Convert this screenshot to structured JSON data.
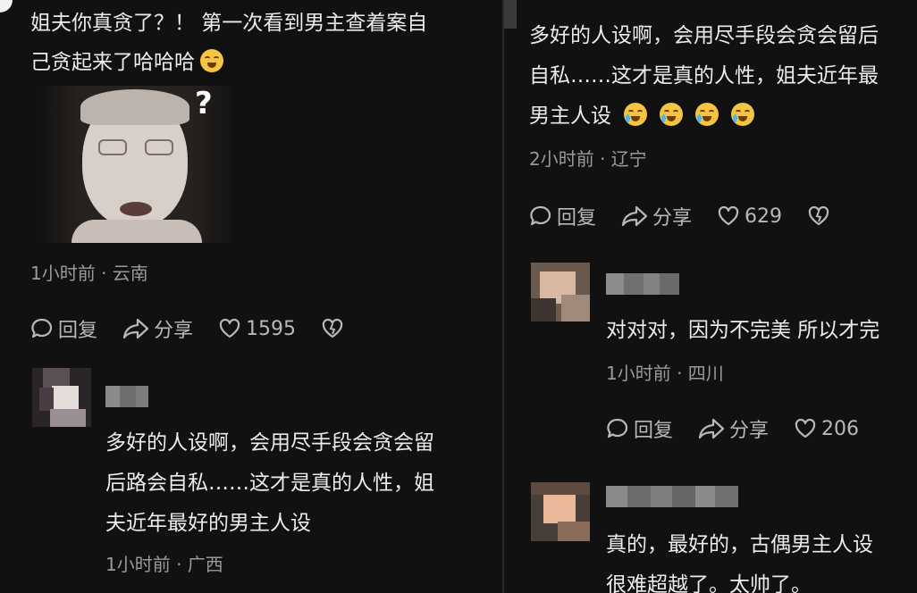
{
  "left": {
    "comment1": {
      "line1": "姐夫你真贪了？！ 第一次看到男主查着案自",
      "line2": "己贪起来了哈哈哈",
      "emoji": "laughing-emoji",
      "image_mark": "?",
      "meta": "1小时前 · 云南",
      "reply": "回复",
      "share": "分享",
      "likes": "1595"
    },
    "reply1": {
      "line1": "多好的人设啊，会用尽手段会贪会留",
      "line2": "后路会自私……这才是真的人性，姐",
      "line3": "夫近年最好的男主人设",
      "meta": "1小时前 · 广西"
    }
  },
  "right": {
    "comment1": {
      "line1": "多好的人设啊，会用尽手段会贪会留后",
      "line2": "自私……这才是真的人性，姐夫近年最",
      "line3": "男主人设",
      "emoji": "crying-emoji",
      "meta": "2小时前 · 辽宁",
      "reply": "回复",
      "share": "分享",
      "likes": "629"
    },
    "reply1": {
      "line1": "对对对，因为不完美 所以才完",
      "meta": "1小时前 · 四川",
      "reply": "回复",
      "share": "分享",
      "likes": "206"
    },
    "reply2": {
      "line1": "真的，最好的，古偶男主人设",
      "line2": "很难超越了。太帅了。"
    }
  },
  "colors": {
    "background": "#111111",
    "text": "#ececec",
    "meta": "#9a9a9a",
    "emoji": "#f5c542"
  }
}
